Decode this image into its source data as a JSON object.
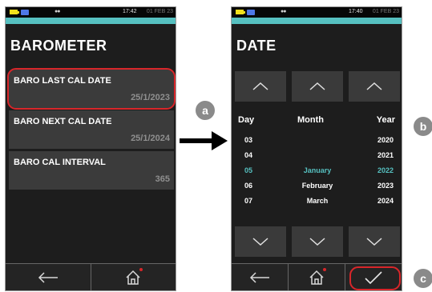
{
  "status_left": {
    "time": "17:42",
    "date": "01 FEB 23"
  },
  "status_right": {
    "time": "17:40",
    "date": "01 FEB 23"
  },
  "barometer": {
    "title": "BAROMETER",
    "items": [
      {
        "label": "BARO LAST CAL DATE",
        "value": "25/1/2023"
      },
      {
        "label": "BARO NEXT CAL DATE",
        "value": "25/1/2024"
      },
      {
        "label": "BARO CAL INTERVAL",
        "value": "365"
      }
    ]
  },
  "date_screen": {
    "title": "DATE",
    "headers": {
      "day": "Day",
      "month": "Month",
      "year": "Year"
    },
    "days": [
      "03",
      "04",
      "05",
      "06",
      "07"
    ],
    "months": [
      "",
      "",
      "January",
      "February",
      "March"
    ],
    "years": [
      "2020",
      "2021",
      "2022",
      "2023",
      "2024"
    ],
    "selected_row": 2
  },
  "callouts": {
    "a": "a",
    "b": "b",
    "c": "c"
  },
  "icons": {
    "back": "back-arrow-icon",
    "home": "home-icon",
    "confirm": "checkmark-icon",
    "up": "chevron-up-icon",
    "down": "chevron-down-icon",
    "flow": "right-arrow-icon"
  },
  "colors": {
    "accent_teal": "#56c0c0",
    "highlight_red": "#d8262a",
    "panel": "#3b3b3b",
    "screen_bg": "#1d1d1d"
  }
}
